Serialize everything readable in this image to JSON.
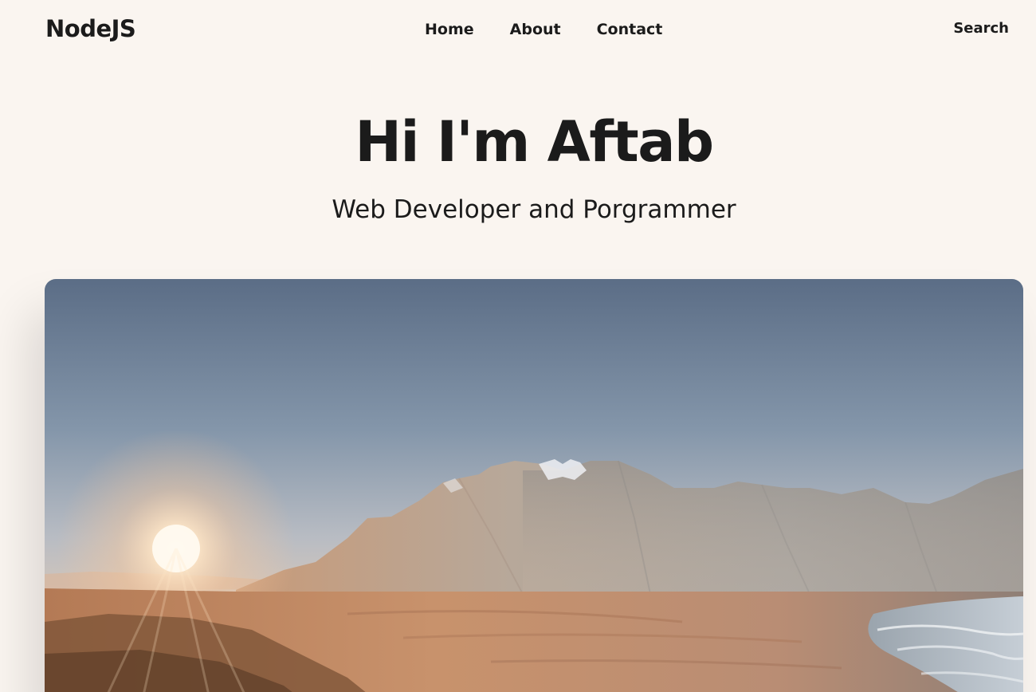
{
  "navbar": {
    "brand": "NodeJS",
    "links": [
      {
        "label": "Home"
      },
      {
        "label": "About"
      },
      {
        "label": "Contact"
      }
    ],
    "search_label": "Search"
  },
  "hero": {
    "title": "Hi I'm Aftab",
    "subtitle": "Web Developer and Porgrammer"
  },
  "hero_image": {
    "description_icon": "landscape-photo"
  }
}
